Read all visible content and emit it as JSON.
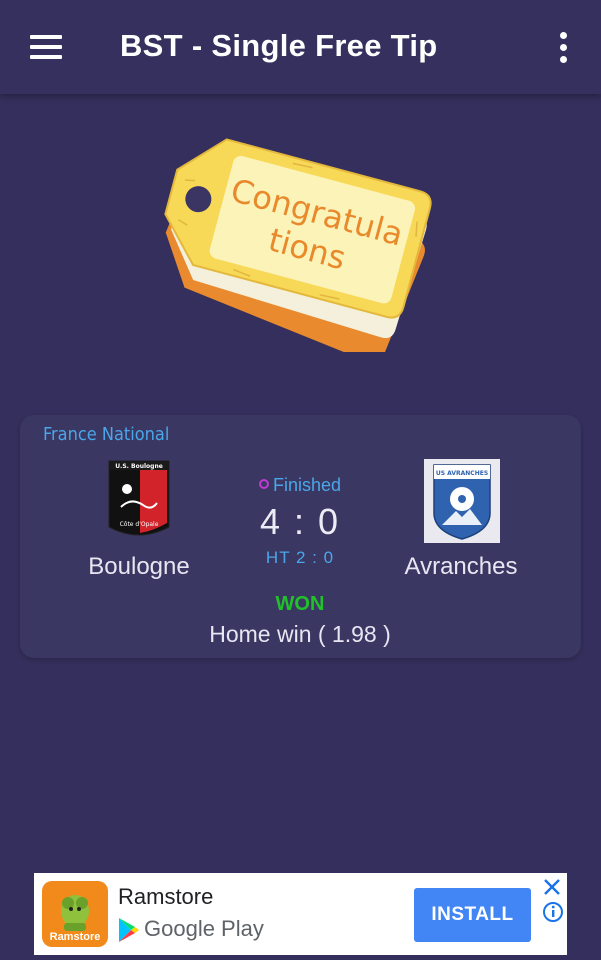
{
  "app": {
    "title": "BST - Single Free Tip",
    "menu_icon": "hamburger-menu-icon",
    "more_icon": "more-vert-icon"
  },
  "banner": {
    "text_line1": "Congratula",
    "text_line2": "tions",
    "colors": {
      "tag_front": "#f7d857",
      "tag_back": "#e98a2e",
      "text": "#e8892b"
    }
  },
  "match": {
    "league": "France National",
    "status": "Finished",
    "home_team": "Boulogne",
    "away_team": "Avranches",
    "score": "4 : 0",
    "halftime": "HT  2 : 0",
    "result": "WON",
    "pick": "Home win  ( 1.98 )",
    "home_logo_text_top": "U.S. Boulogne",
    "home_logo_text_bottom": "Côte d'Opale",
    "away_logo_text": "US AVRANCHES",
    "colors": {
      "accent": "#4aa6e8",
      "won": "#21c12a",
      "status_dot": "#c23ad0"
    }
  },
  "ad": {
    "app_name": "Ramstore",
    "icon_label": "Ramstore",
    "store": "Google Play",
    "install_label": "INSTALL",
    "colors": {
      "install": "#4285f4",
      "close": "#1a73e8"
    }
  }
}
